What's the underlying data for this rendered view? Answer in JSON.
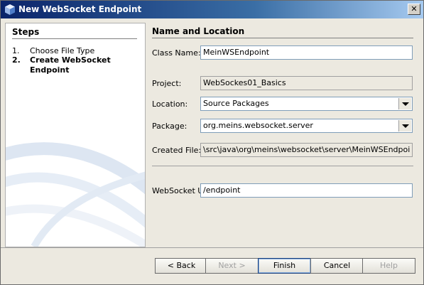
{
  "window": {
    "title": "New WebSocket Endpoint",
    "close_glyph": "✕"
  },
  "steps": {
    "heading": "Steps",
    "items": [
      {
        "num": "1.",
        "label": "Choose File Type",
        "active": false
      },
      {
        "num": "2.",
        "label": "Create WebSocket Endpoint",
        "active": true
      }
    ]
  },
  "main": {
    "heading": "Name and Location",
    "class_name": {
      "label": "Class Name:",
      "value": "MeinWSEndpoint"
    },
    "project": {
      "label": "Project:",
      "value": "WebSockes01_Basics"
    },
    "location": {
      "label": "Location:",
      "value": "Source Packages"
    },
    "package": {
      "label": "Package:",
      "value": "org.meins.websocket.server"
    },
    "created_file": {
      "label": "Created File:",
      "value": "\\src\\java\\org\\meins\\websocket\\server\\MeinWSEndpoint.java"
    },
    "websocket_uri": {
      "label": "WebSocket URI:",
      "value": "/endpoint"
    }
  },
  "buttons": {
    "back": "< Back",
    "next": "Next >",
    "finish": "Finish",
    "cancel": "Cancel",
    "help": "Help"
  }
}
